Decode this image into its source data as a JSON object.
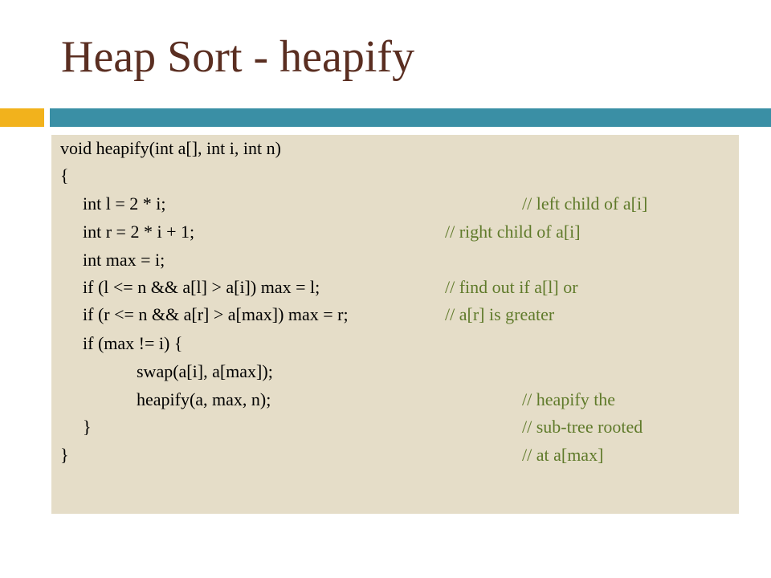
{
  "slide": {
    "title": "Heap Sort - heapify"
  },
  "code": {
    "lines": [
      {
        "code": "void heapify(int a[], int i, int n)",
        "comment": ""
      },
      {
        "code": "{",
        "comment": ""
      },
      {
        "code": "int l = 2 * i;",
        "comment": "// left child of a[i]"
      },
      {
        "code": "int r = 2 * i + 1;",
        "comment": "// right child of a[i]"
      },
      {
        "code": "int max = i;",
        "comment": ""
      },
      {
        "code": "if (l <= n && a[l] > a[i]) max = l;",
        "comment": "// find out if a[l] or"
      },
      {
        "code": "if (r <= n && a[r] > a[max]) max = r;",
        "comment": "// a[r] is greater"
      },
      {
        "code": "if (max != i) {",
        "comment": ""
      },
      {
        "code": "swap(a[i], a[max]);",
        "comment": ""
      },
      {
        "code": "heapify(a, max, n);",
        "comment": "// heapify the"
      },
      {
        "code": "}",
        "comment": "// sub-tree rooted"
      },
      {
        "code": "}",
        "comment": "// at a[max]"
      }
    ]
  },
  "colors": {
    "title": "#5a2e21",
    "accent_left": "#f2b21c",
    "accent_main": "#3a8fa5",
    "panel_bg": "#e5ddc8",
    "comment": "#5f7a2a"
  }
}
